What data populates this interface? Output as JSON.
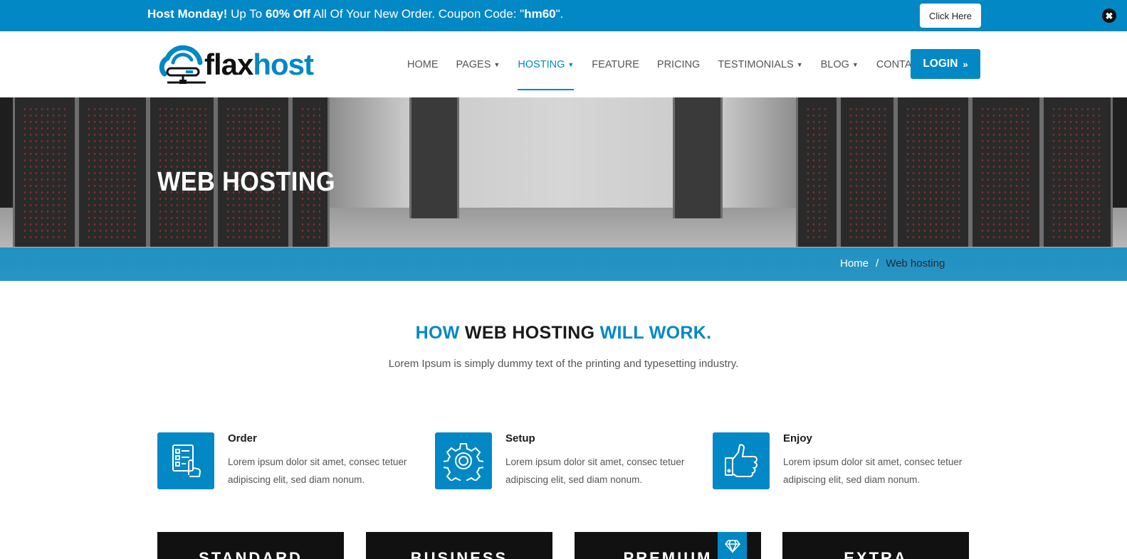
{
  "promo": {
    "bold_1": "Host Monday!",
    "text_1": " Up To ",
    "bold_2": "60% Off",
    "text_2": " All Of Your New Order. Coupon Code: \"",
    "bold_3": "hm60",
    "text_3": "\".",
    "button_label": "Click Here",
    "close_icon": "✖"
  },
  "logo": {
    "part_1": "flax",
    "part_2": "host"
  },
  "nav": {
    "items": [
      {
        "label": "HOME",
        "caret": ""
      },
      {
        "label": "PAGES",
        "caret": "⌄"
      },
      {
        "label": "HOSTING",
        "caret": "⌄"
      },
      {
        "label": "FEATURE",
        "caret": ""
      },
      {
        "label": "PRICING",
        "caret": ""
      },
      {
        "label": "TESTIMONIALS",
        "caret": "⌄"
      },
      {
        "label": "BLOG",
        "caret": "⌄"
      },
      {
        "label": "CONTACT",
        "caret": ""
      }
    ],
    "login_label": "LOGIN",
    "login_icon": "»"
  },
  "hero": {
    "title": "WEB HOSTING",
    "breadcrumb": {
      "home": "Home",
      "separator": "/",
      "current": "Web hosting"
    }
  },
  "section": {
    "title_part_1": "HOW",
    "title_part_2": "WEB HOSTING",
    "title_part_3": "WILL WORK.",
    "subtitle": "Lorem Ipsum is simply dummy text of the printing and typesetting industry."
  },
  "steps": [
    {
      "icon": "checklist-hand-icon",
      "title": "Order",
      "text": "Lorem ipsum dolor sit amet, consec tetuer adipiscing elit, sed diam nonum."
    },
    {
      "icon": "gear-icon",
      "title": "Setup",
      "text": "Lorem ipsum dolor sit amet, consec tetuer adipiscing elit, sed diam nonum."
    },
    {
      "icon": "thumbs-up-icon",
      "title": "Enjoy",
      "text": "Lorem ipsum dolor sit amet, consec tetuer adipiscing elit, sed diam nonum."
    }
  ],
  "plans": [
    {
      "title": "STANDARD"
    },
    {
      "title": "BUSINESS"
    },
    {
      "title": "PREMIUM",
      "badge_icon": "diamond-icon"
    },
    {
      "title": "EXTRA"
    }
  ],
  "colors": {
    "accent": "#0288c5",
    "dark": "#111111",
    "text": "#555555"
  }
}
